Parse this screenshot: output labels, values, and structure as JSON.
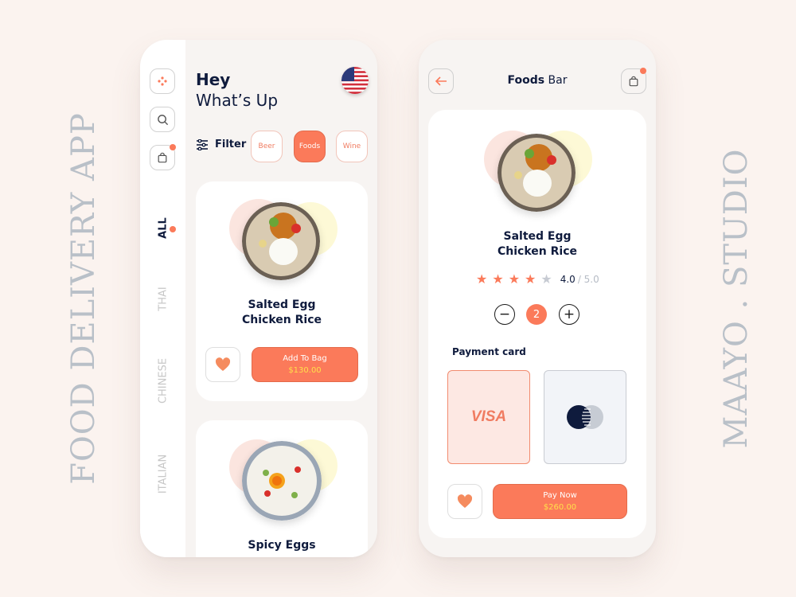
{
  "side_titles": {
    "left": "FOOD DELIVERY APP",
    "right": "MAAYO . STUDIO"
  },
  "left_screen": {
    "greeting": "Hey",
    "subtitle": "What’s Up",
    "filter_label": "Filter",
    "chips": [
      "Beer",
      "Foods",
      "Wine"
    ],
    "active_chip": "Foods",
    "categories": [
      "ALL",
      "THAI",
      "CHINESE",
      "ITALIAN"
    ],
    "active_category": "ALL",
    "cards": [
      {
        "name_line1": "Salted Egg",
        "name_line2": "Chicken Rice",
        "button_label": "Add To Bag",
        "price": "$130.00"
      },
      {
        "name_line1": "Spicy Eggs"
      }
    ]
  },
  "right_screen": {
    "title_bold": "Foods",
    "title_rest": " Bar",
    "food_line1": "Salted Egg",
    "food_line2": "Chicken Rice",
    "rating": "4.0",
    "rating_max": "/ 5.0",
    "stars_filled": 4,
    "stars_total": 5,
    "quantity": "2",
    "minus": "−",
    "plus": "+",
    "payment_label": "Payment card",
    "visa_label": "VISA",
    "pay_button_label": "Pay Now",
    "pay_price": "$260.00"
  },
  "colors": {
    "accent": "#fb7a5a",
    "price": "#ffe04a",
    "dark": "#0f1b3d",
    "visa_bg": "#fde8e3",
    "mc_bg": "#f2f4f8"
  },
  "icons": [
    "dots-icon",
    "search-icon",
    "bag-icon",
    "filter-icon",
    "heart-icon",
    "back-arrow-icon",
    "star-icon",
    "mastercard-icon",
    "us-flag-icon"
  ]
}
